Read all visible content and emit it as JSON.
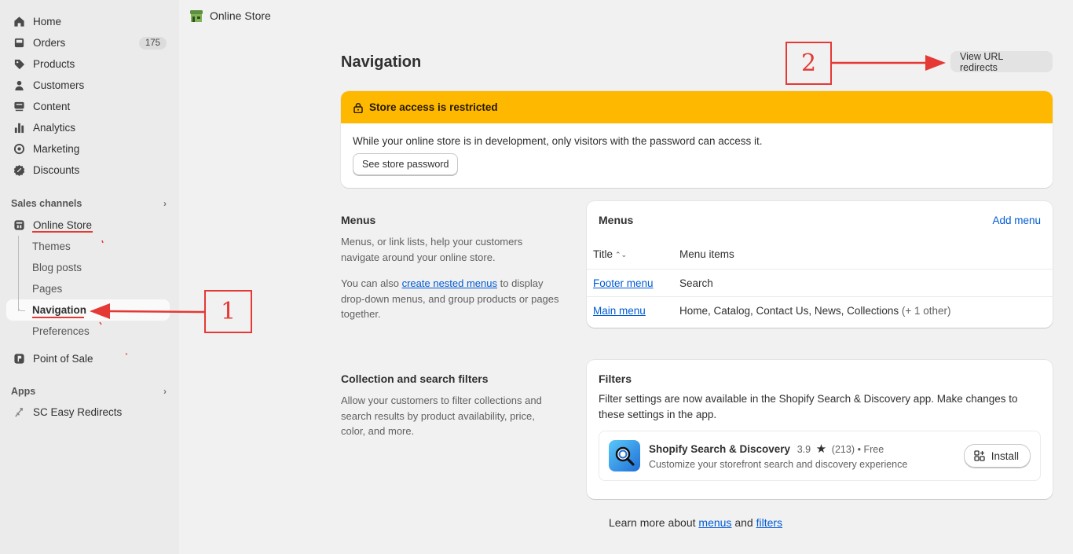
{
  "sidebar": {
    "items": [
      {
        "label": "Home",
        "icon": "home-icon"
      },
      {
        "label": "Orders",
        "icon": "inbox-icon",
        "badge": "175"
      },
      {
        "label": "Products",
        "icon": "tag-icon"
      },
      {
        "label": "Customers",
        "icon": "person-icon"
      },
      {
        "label": "Content",
        "icon": "content-icon"
      },
      {
        "label": "Analytics",
        "icon": "bar-chart-icon"
      },
      {
        "label": "Marketing",
        "icon": "target-icon"
      },
      {
        "label": "Discounts",
        "icon": "discount-icon"
      }
    ],
    "sales_channels_label": "Sales channels",
    "online_store_label": "Online Store",
    "online_store_sub": [
      "Themes",
      "Blog posts",
      "Pages",
      "Navigation",
      "Preferences"
    ],
    "point_of_sale_label": "Point of Sale",
    "apps_label": "Apps",
    "app_item_label": "SC Easy Redirects"
  },
  "topbar": {
    "title": "Online Store"
  },
  "page": {
    "title": "Navigation",
    "view_redirects_label": "View URL redirects"
  },
  "banner": {
    "title": "Store access is restricted",
    "body": "While your online store is in development, only visitors with the password can access it.",
    "button_label": "See store password"
  },
  "menus_section": {
    "heading": "Menus",
    "desc": "Menus, or link lists, help your customers navigate around your online store.",
    "desc2_prefix": "You can also ",
    "desc2_link": "create nested menus",
    "desc2_suffix": " to display drop-down menus, and group products or pages together."
  },
  "menus_card": {
    "title": "Menus",
    "add_label": "Add menu",
    "col_title": "Title",
    "col_items": "Menu items",
    "rows": [
      {
        "title": "Footer menu",
        "items": "Search",
        "extra": ""
      },
      {
        "title": "Main menu",
        "items": "Home, Catalog, Contact Us, News, Collections",
        "extra": "(+ 1 other)"
      }
    ]
  },
  "filters_section": {
    "heading": "Collection and search filters",
    "desc": "Allow your customers to filter collections and search results by product availability, price, color, and more."
  },
  "filters_card": {
    "title": "Filters",
    "desc": "Filter settings are now available in the Shopify Search & Discovery app. Make changes to these settings in the app.",
    "app_name": "Shopify Search & Discovery",
    "rating": "3.9",
    "reviews": "(213)",
    "price": "Free",
    "app_desc": "Customize your storefront search and discovery experience",
    "install_label": "Install"
  },
  "learn_more": {
    "prefix": "Learn more about ",
    "link1": "menus",
    "middle": " and ",
    "link2": "filters"
  },
  "annotations": {
    "box1": "1",
    "box2": "2"
  },
  "colors": {
    "banner": "#ffb800",
    "link": "#005bd3",
    "annotation": "#e53935"
  }
}
